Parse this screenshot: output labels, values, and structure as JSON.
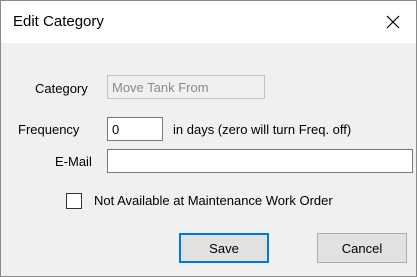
{
  "window": {
    "title": "Edit Category",
    "close_icon": "close-icon"
  },
  "form": {
    "category_label": "Category",
    "category_value": "Move Tank From",
    "frequency_label": "Frequency",
    "frequency_value": "0",
    "frequency_hint": "in days (zero will turn Freq. off)",
    "email_label": "E-Mail",
    "email_value": "",
    "not_available_label": "Not Available at Maintenance Work Order",
    "not_available_checked": false
  },
  "buttons": {
    "save": "Save",
    "cancel": "Cancel"
  },
  "colors": {
    "default_button_border": "#0078d7"
  }
}
